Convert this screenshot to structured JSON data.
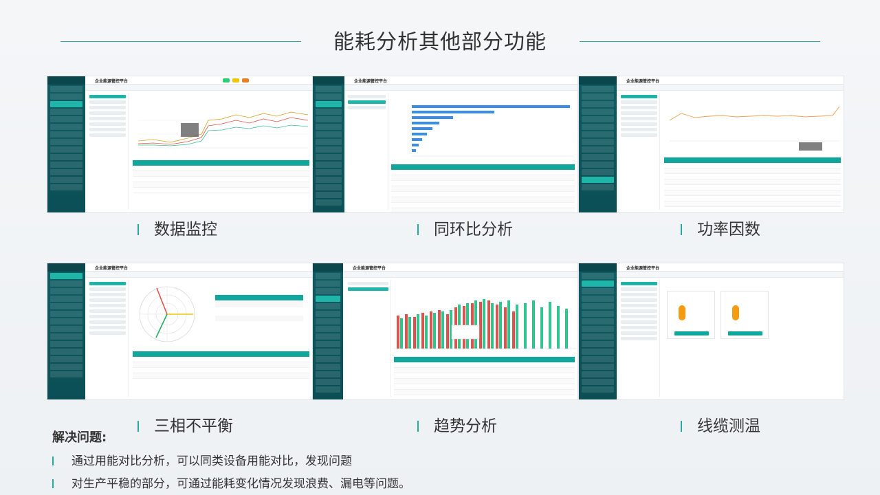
{
  "slide": {
    "title": "能耗分析其他部分功能"
  },
  "screens": {
    "app_name": "企业能源管控平台",
    "captions": [
      "数据监控",
      "同环比分析",
      "功率因数",
      "三相不平衡",
      "趋势分析",
      "线缆测温"
    ]
  },
  "problems": {
    "title": "解决问题:",
    "items": [
      "通过用能对比分析，可以同类设备用能对比，发现问题",
      "对生产平稳的部分，可通过能耗变化情况发现浪费、漏电等问题。"
    ]
  },
  "colors": {
    "accent": "#2aa6a0",
    "sidebar": "#0e5d63",
    "header_teal": "#10a69c",
    "bar_red": "#e0514a",
    "bar_green": "#34c38f",
    "bar_blue": "#3a8ee6"
  }
}
